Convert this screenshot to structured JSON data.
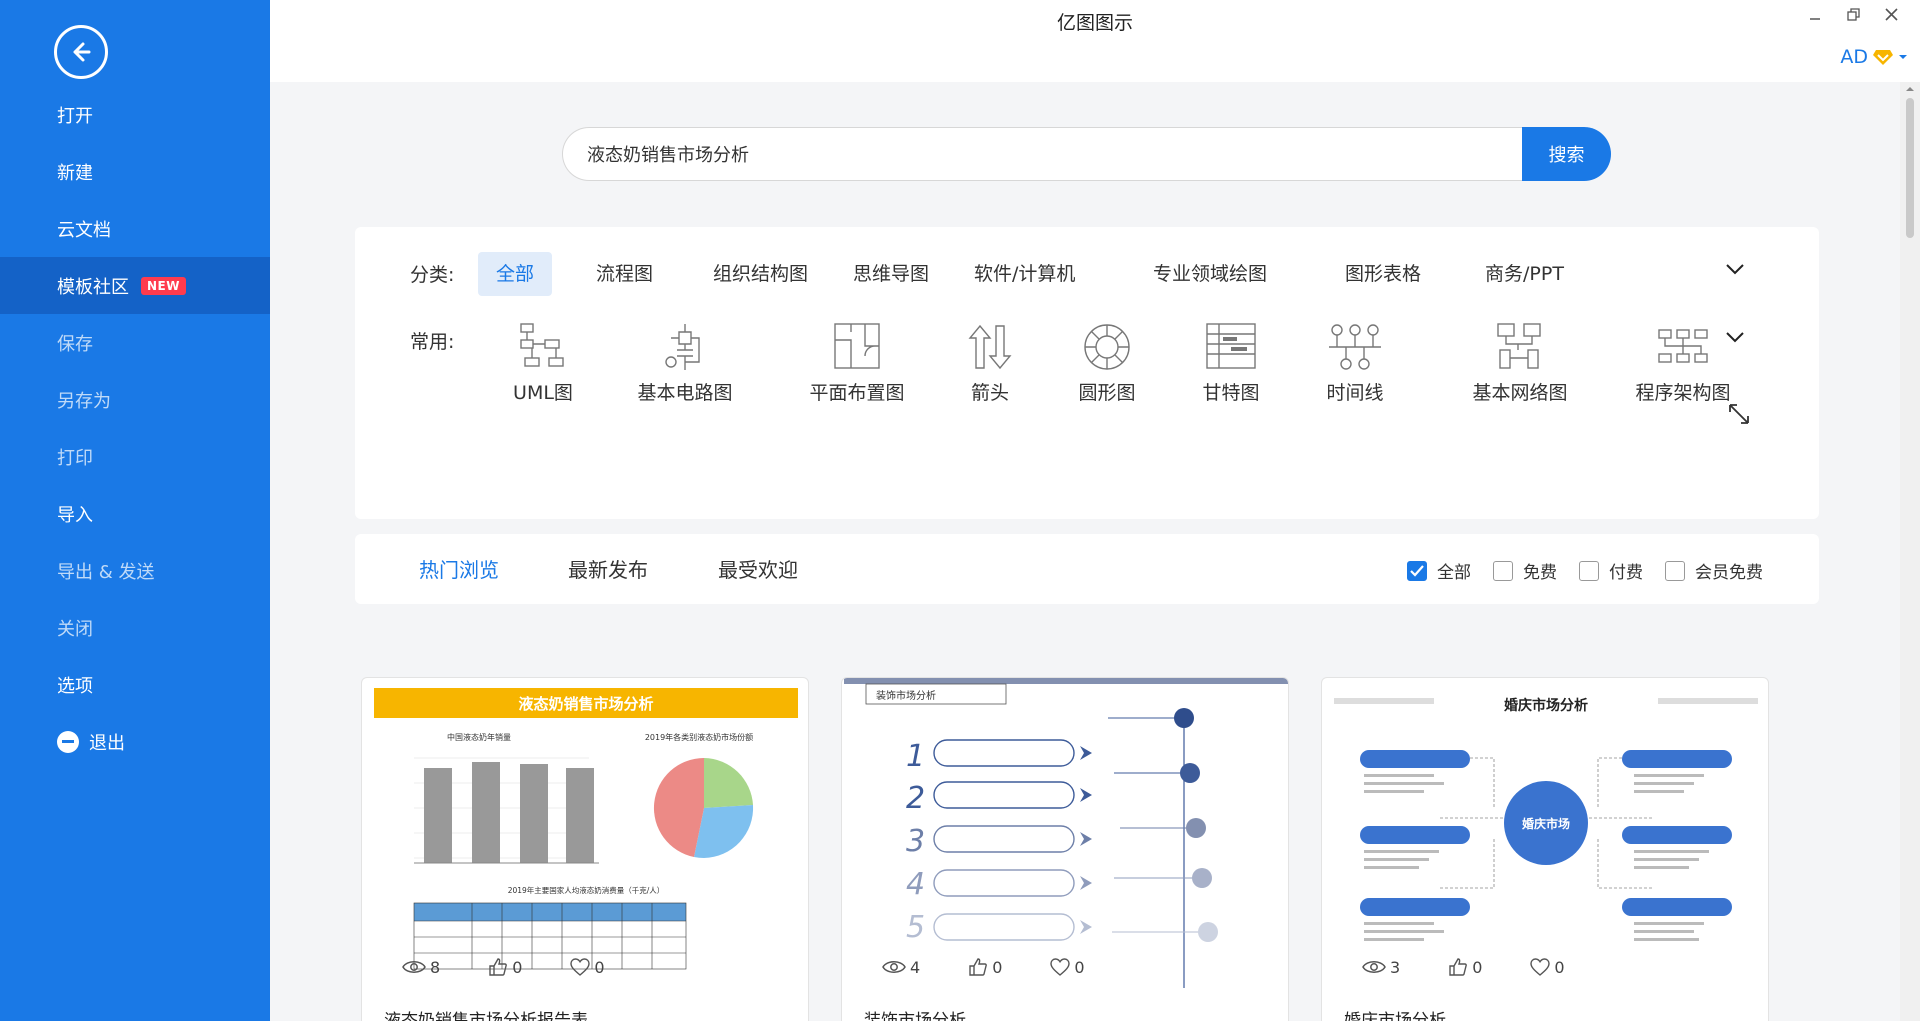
{
  "app": {
    "title": "亿图图示",
    "user": "AD"
  },
  "sidebar": {
    "items": [
      {
        "label": "打开",
        "style": "normal"
      },
      {
        "label": "新建",
        "style": "normal"
      },
      {
        "label": "云文档",
        "style": "normal"
      },
      {
        "label": "模板社区",
        "badge": "NEW",
        "style": "active"
      },
      {
        "label": "保存",
        "style": "dim"
      },
      {
        "label": "另存为",
        "style": "dim"
      },
      {
        "label": "打印",
        "style": "dim"
      },
      {
        "label": "导入",
        "style": "normal"
      },
      {
        "label": "导出 & 发送",
        "style": "dim"
      },
      {
        "label": "关闭",
        "style": "dim"
      },
      {
        "label": "选项",
        "style": "normal"
      },
      {
        "label": "退出",
        "style": "normal"
      }
    ]
  },
  "search": {
    "value": "液态奶销售市场分析",
    "button": "搜索"
  },
  "filters": {
    "category_label": "分类:",
    "categories": [
      "全部",
      "流程图",
      "组织结构图",
      "思维导图",
      "软件/计算机",
      "专业领域绘图",
      "图形表格",
      "商务/PPT"
    ],
    "common_label": "常用:",
    "common": [
      "UML图",
      "基本电路图",
      "平面布置图",
      "箭头",
      "圆形图",
      "甘特图",
      "时间线",
      "基本网络图",
      "程序架构图"
    ]
  },
  "tabs": [
    "热门浏览",
    "最新发布",
    "最受欢迎"
  ],
  "price_filters": [
    {
      "label": "全部",
      "checked": true
    },
    {
      "label": "免费",
      "checked": false
    },
    {
      "label": "付费",
      "checked": false
    },
    {
      "label": "会员免费",
      "checked": false
    }
  ],
  "cards": [
    {
      "title": "液态奶销售市场分析报告表",
      "views": "8",
      "likes": "0",
      "favorites": "0",
      "thumb": {
        "header": "液态奶销售市场分析",
        "subtitle_left": "中国液态奶年销量",
        "subtitle_right": "2019年各类别液态奶市场份额",
        "table_title": "2019年主要国家人均液态奶消费量（千克/人）"
      }
    },
    {
      "title": "装饰市场分析",
      "views": "4",
      "likes": "0",
      "favorites": "0",
      "thumb": {
        "header": "装饰市场分析",
        "steps": [
          "1",
          "2",
          "3",
          "4",
          "5"
        ]
      }
    },
    {
      "title": "婚庆市场分析",
      "views": "3",
      "likes": "0",
      "favorites": "0",
      "thumb": {
        "header": "婚庆市场分析",
        "center": "婚庆市场"
      }
    }
  ],
  "colors": {
    "accent": "#1a79e6",
    "sidebar": "#1a79e6",
    "badge": "#ff3b4e"
  }
}
